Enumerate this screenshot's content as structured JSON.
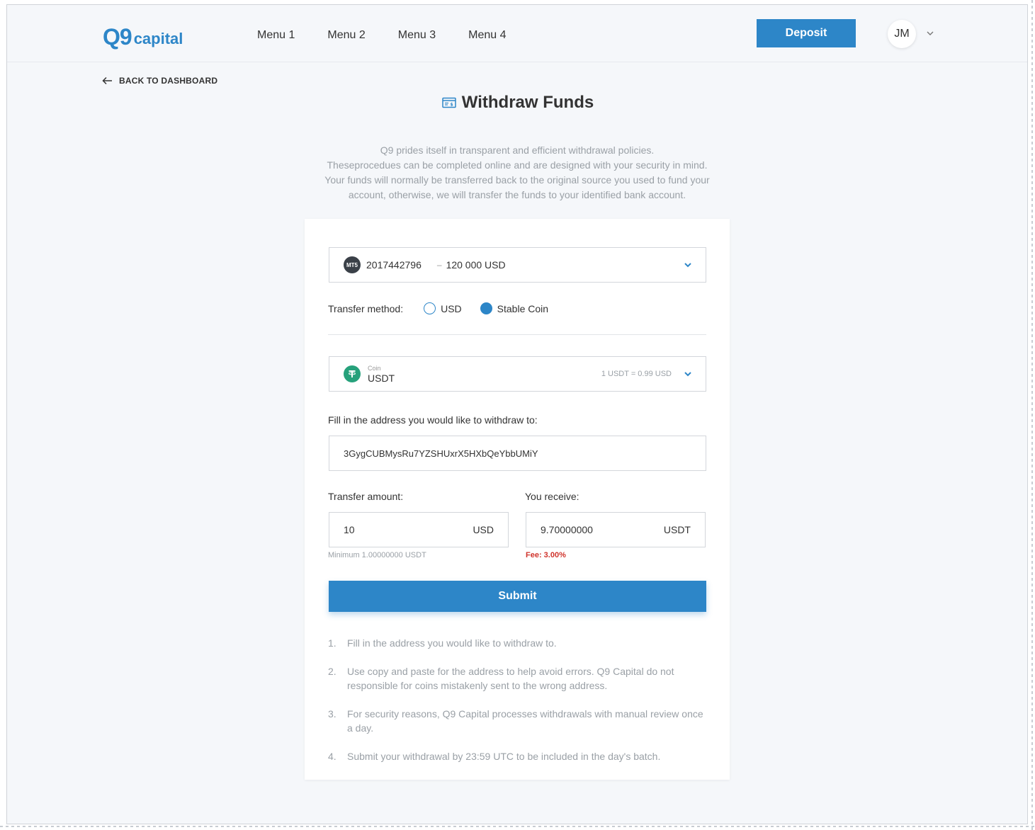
{
  "header": {
    "logo_q9": "Q9",
    "logo_capital": "capital",
    "menu": [
      "Menu 1",
      "Menu 2",
      "Menu 3",
      "Menu 4"
    ],
    "deposit_label": "Deposit",
    "avatar_initials": "JM"
  },
  "back_label": "BACK TO DASHBOARD",
  "page_title": "Withdraw Funds",
  "intro": [
    "Q9 prides itself in transparent and efficient withdrawal policies.",
    "Theseprocedues can be completed online and are designed with your security in mind.",
    "Your funds will normally be transferred back to the original source you used to fund your",
    "account, otherwise, we will transfer the funds to your identified bank account."
  ],
  "account": {
    "badge": "MT5",
    "number": "2017442796",
    "separator": "–",
    "balance": "120 000 USD"
  },
  "transfer_method": {
    "label": "Transfer method:",
    "options": [
      "USD",
      "Stable Coin"
    ],
    "selected": "Stable Coin"
  },
  "coin": {
    "caption": "Coin",
    "name": "USDT",
    "rate": "1 USDT = 0.99 USD"
  },
  "address": {
    "label": "Fill in the address you would like to withdraw to:",
    "value": "3GygCUBMysRu7YZSHUxrX5HXbQeYbbUMiY"
  },
  "transfer_amount": {
    "label": "Transfer amount:",
    "value": "10",
    "unit": "USD",
    "hint": "Minimum 1.00000000 USDT"
  },
  "receive": {
    "label": "You receive:",
    "value": "9.70000000",
    "unit": "USDT",
    "fee": "Fee: 3.00%"
  },
  "submit_label": "Submit",
  "notes": [
    "Fill in the address you would like to withdraw to.",
    "Use copy and paste for the address to help avoid errors. Q9 Capital do not responsible for coins mistakenly sent to the wrong address.",
    "For security reasons, Q9 Capital processes withdrawals with manual review once a day.",
    "Submit your withdrawal by 23:59 UTC to be included in the day's batch."
  ],
  "colors": {
    "accent": "#2d86c8",
    "fee_red": "#d0342c",
    "tether_green": "#26a17b"
  }
}
